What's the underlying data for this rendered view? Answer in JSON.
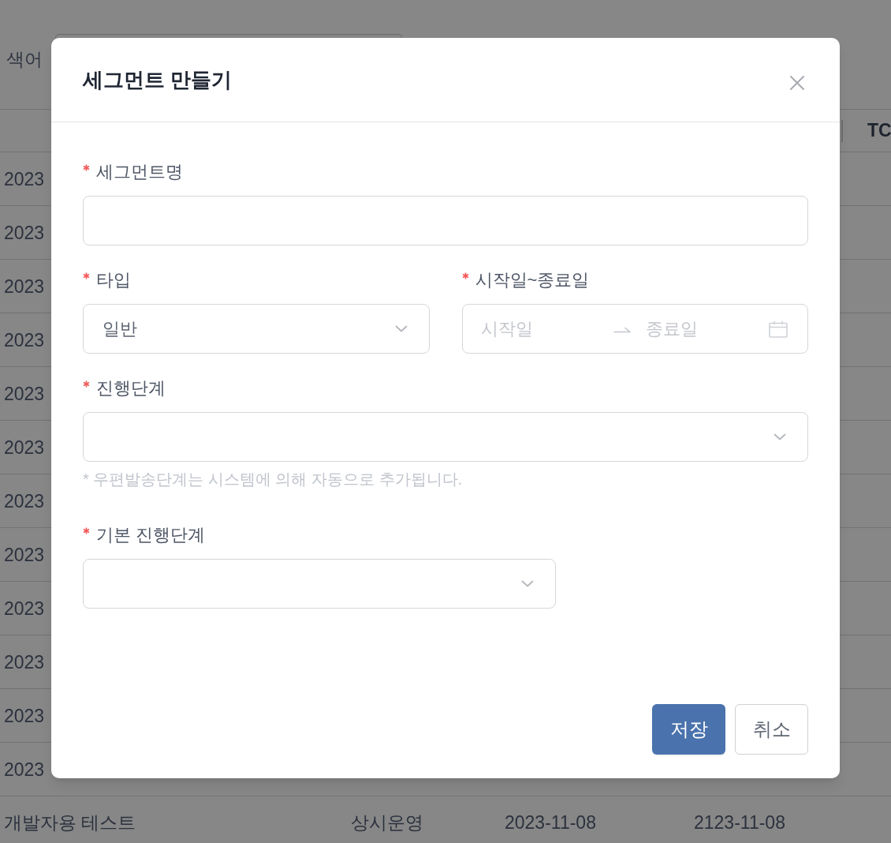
{
  "background_page": {
    "search": {
      "label": "색어"
    },
    "table": {
      "columns": [
        {
          "label": "TC"
        }
      ],
      "rows": [
        {
          "cells": [
            "2023"
          ]
        },
        {
          "cells": [
            "2023"
          ]
        },
        {
          "cells": [
            "2023"
          ]
        },
        {
          "cells": [
            "2023"
          ]
        },
        {
          "cells": [
            "2023"
          ]
        },
        {
          "cells": [
            "2023"
          ]
        },
        {
          "cells": [
            "2023"
          ]
        },
        {
          "cells": [
            "2023"
          ]
        },
        {
          "cells": [
            "2023"
          ]
        },
        {
          "cells": [
            "2023"
          ]
        },
        {
          "cells": [
            "2023"
          ]
        },
        {
          "cells": [
            "2023"
          ]
        },
        {
          "cells": [
            "개발자용 테스트",
            "상시운영",
            "2023-11-08",
            "2123-11-08"
          ]
        }
      ]
    }
  },
  "dialog": {
    "title": "세그먼트 만들기",
    "rows": [
      [
        {
          "kind": "text",
          "label": "세그먼트명",
          "required": true
        }
      ],
      [
        {
          "kind": "select",
          "label": "타입",
          "required": true,
          "value": "일반"
        },
        {
          "kind": "date_range",
          "label": "시작일~종료일",
          "required": true,
          "start": {
            "placeholder": "시작일"
          },
          "end": {
            "placeholder": "종료일"
          }
        }
      ],
      [
        {
          "kind": "select",
          "label": "진행단계",
          "required": true,
          "hint": "* 우편발송단계는 시스템에 의해 자동으로 추가됩니다."
        }
      ],
      [
        {
          "kind": "select",
          "label": "기본 진행단계",
          "required": true
        }
      ]
    ],
    "buttons": [
      {
        "label": "저장",
        "kind": "primary"
      },
      {
        "label": "취소",
        "kind": "default"
      }
    ]
  }
}
